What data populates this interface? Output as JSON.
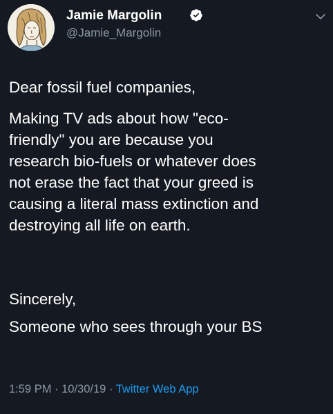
{
  "author": {
    "display_name": "Jamie Margolin",
    "handle": "@Jamie_Margolin",
    "verified_icon": "verified-badge-icon",
    "avatar_icon": "illustrated-portrait-avatar"
  },
  "menu_icon": "chevron-down-icon",
  "tweet": {
    "greeting": "Dear fossil fuel companies,",
    "message_lines": [
      "Making TV ads about how \"eco-",
      "friendly\" you are because you",
      "research bio-fuels or whatever does",
      "not erase the fact that your greed is",
      "causing a literal mass extinction and",
      "destroying all life on earth."
    ],
    "signoff": "Sincerely,",
    "signature": "Someone who sees through your BS"
  },
  "meta": {
    "time": "1:59 PM",
    "separator": " · ",
    "date": "10/30/19",
    "separator2": " · ",
    "source": "Twitter Web App"
  },
  "colors": {
    "background": "#151a22",
    "text": "#ffffff",
    "secondary": "#8b98a5",
    "link": "#1d9bf0"
  }
}
